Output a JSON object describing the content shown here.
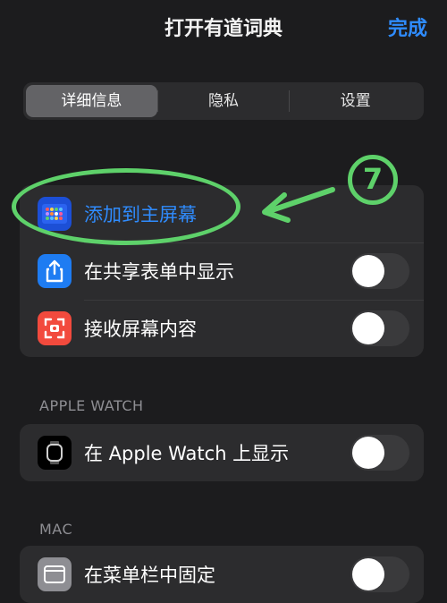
{
  "header": {
    "title": "打开有道词典",
    "done_label": "完成"
  },
  "tabs": [
    {
      "label": "详细信息",
      "active": true
    },
    {
      "label": "隐私",
      "active": false
    },
    {
      "label": "设置",
      "active": false
    }
  ],
  "group_main": {
    "rows": [
      {
        "label": "添加到主屏幕",
        "icon": "app-grid-icon"
      },
      {
        "label": "在共享表单中显示",
        "icon": "share-icon",
        "toggle": false
      },
      {
        "label": "接收屏幕内容",
        "icon": "screen-capture-icon",
        "toggle": false
      }
    ]
  },
  "watch_section": {
    "header": "APPLE WATCH",
    "rows": [
      {
        "label": "在 Apple Watch 上显示",
        "icon": "apple-watch-icon",
        "toggle": false
      }
    ]
  },
  "mac_section": {
    "header": "MAC",
    "rows": [
      {
        "label": "在菜单栏中固定",
        "icon": "menubar-icon",
        "toggle": false
      }
    ]
  },
  "annotation": {
    "step_number": "7",
    "color": "#5ed16a"
  },
  "colors": {
    "accent": "#2f8cff",
    "background": "#1c1c1e",
    "group": "#2c2c2e"
  }
}
